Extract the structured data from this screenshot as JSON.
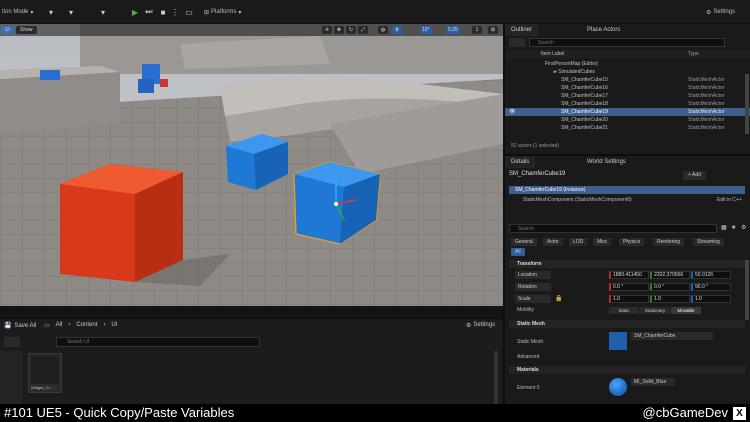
{
  "toolbar": {
    "mode": "tion Mode",
    "platforms": "Platforms",
    "settings": "Settings"
  },
  "viewport": {
    "perspective": "",
    "show": "Show",
    "left_tag": "Ui",
    "snap_angle": "10°",
    "snap_scale": "0.25",
    "camera_speed": "1"
  },
  "outliner": {
    "tab": "Outliner",
    "tab2": "Place Actors",
    "search_placeholder": "Search",
    "col_label": "Item Label",
    "col_type": "Type",
    "rows": [
      {
        "label": "FirstPersonMap (Editor)",
        "type": ""
      },
      {
        "label": "SimulatedCubes",
        "type": ""
      },
      {
        "label": "SM_ChamferCube15",
        "type": "StaticMeshActor"
      },
      {
        "label": "SM_ChamferCube16",
        "type": "StaticMeshActor"
      },
      {
        "label": "SM_ChamferCube17",
        "type": "StaticMeshActor"
      },
      {
        "label": "SM_ChamferCube18",
        "type": "StaticMeshActor"
      },
      {
        "label": "SM_ChamferCube19",
        "type": "StaticMeshActor"
      },
      {
        "label": "SM_ChamferCube20",
        "type": "StaticMeshActor"
      },
      {
        "label": "SM_ChamferCube21",
        "type": "StaticMeshActor"
      }
    ],
    "status": "52 actors (1 selected)"
  },
  "details": {
    "tab": "Details",
    "tab2": "World Settings",
    "object_name": "SM_ChamferCube19",
    "add_label": "+ Add",
    "instance_label": "SM_ChamferCube19 (Instance)",
    "component_label": "StaticMeshComponent (StaticMeshComponent0)",
    "edit_cpp": "Edit in C++",
    "search_placeholder": "Search",
    "categories": [
      "General",
      "Actor",
      "LOD",
      "Misc",
      "Physics",
      "Rendering",
      "Streaming",
      "All"
    ],
    "transform_header": "Transform",
    "location_label": "Location",
    "location": [
      "1880.411450",
      "2202.370566",
      "50.0126"
    ],
    "rotation_label": "Rotation",
    "rotation": [
      "0.0 °",
      "0.0 °",
      "90.0 °"
    ],
    "scale_label": "Scale",
    "scale": [
      "1.0",
      "1.0",
      "1.0"
    ],
    "mobility_label": "Mobility",
    "mobility_options": [
      "Static",
      "Stationary",
      "Movable"
    ],
    "static_mesh_header": "Static Mesh",
    "static_mesh_label": "Static Mesh",
    "static_mesh_value": "SM_ChamferCube",
    "advanced_label": "Advanced",
    "materials_header": "Materials",
    "element_label": "Element 0",
    "material_value": "MI_Solid_Blue"
  },
  "content_browser": {
    "save_all": "Save All",
    "path": [
      "All",
      "Content",
      "UI"
    ],
    "search_placeholder": "Search UI",
    "settings": "Settings",
    "asset_name": "Widget_Cl..."
  },
  "caption": {
    "left": "#101 UE5 - Quick Copy/Paste Variables",
    "right": "@cbGameDev"
  },
  "colors": {
    "accent": "#0070e0",
    "red_cube": "#e0401e",
    "blue_cube": "#1e7ad6",
    "selection": "#f0a020"
  }
}
